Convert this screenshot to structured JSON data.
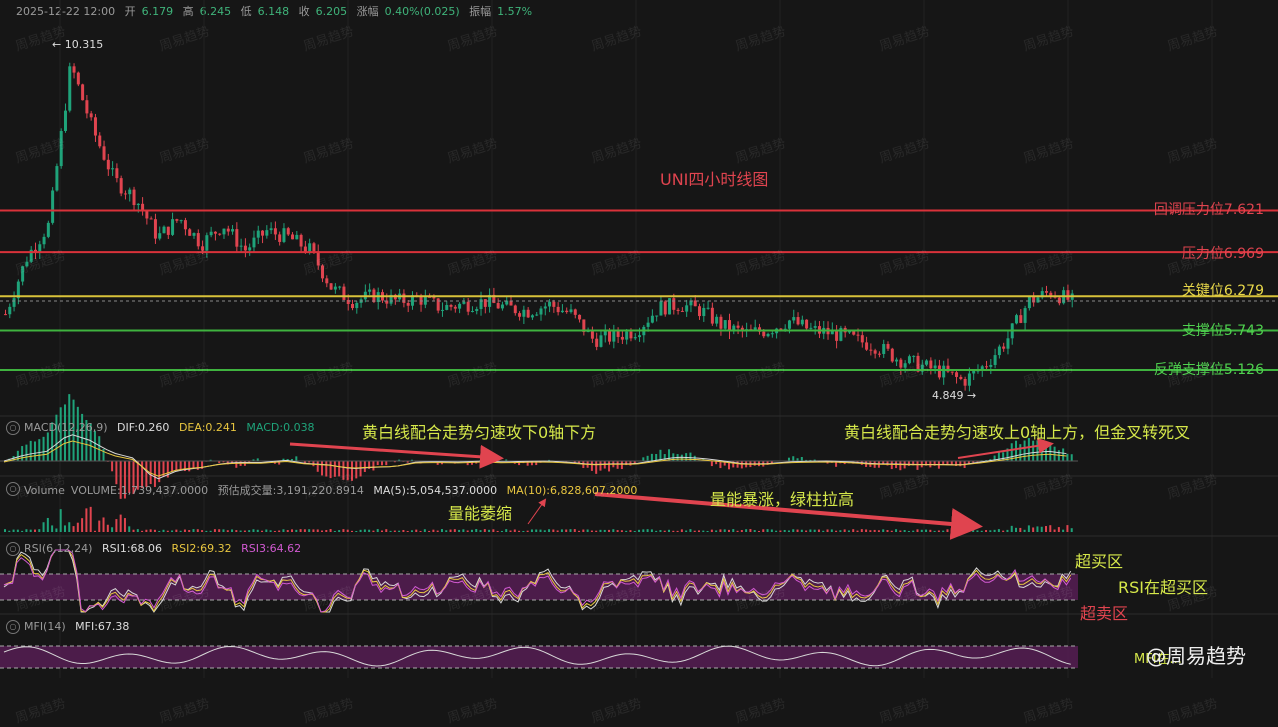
{
  "header": {
    "datetime": "2025-12-22 12:00",
    "open_label": "开",
    "open": "6.179",
    "high_label": "高",
    "high": "6.245",
    "low_label": "低",
    "low": "6.148",
    "close_label": "收",
    "close": "6.205",
    "change_label": "涨幅",
    "change": "0.40%(0.025)",
    "amplitude_label": "振幅",
    "amplitude": "1.57%"
  },
  "chart_data": {
    "type": "candlestick",
    "title": "UNI四小时线图",
    "ylim": [
      4.5,
      10.6
    ],
    "high_marker": "10.315",
    "low_marker": "4.849",
    "levels": [
      {
        "label": "回调压力位7.621",
        "value": 7.621,
        "color": "#d9323a"
      },
      {
        "label": "压力位6.969",
        "value": 6.969,
        "color": "#d9323a"
      },
      {
        "label": "关键位6.279",
        "value": 6.279,
        "color": "#d8c23a"
      },
      {
        "label": "支撑位5.743",
        "value": 5.743,
        "color": "#3fb33f"
      },
      {
        "label": "反弹支撑位5.126",
        "value": 5.126,
        "color": "#3fb33f"
      }
    ],
    "trend_close": [
      6.0,
      6.9,
      7.4,
      9.9,
      8.9,
      8.1,
      7.8,
      7.2,
      7.5,
      7.1,
      7.4,
      7.0,
      7.3,
      7.2,
      7.0,
      6.4,
      6.2,
      6.3,
      6.2,
      6.25,
      6.1,
      6.15,
      6.2,
      6.1,
      6.05,
      6.15,
      6.0,
      5.6,
      5.65,
      5.75,
      6.1,
      6.15,
      6.05,
      5.8,
      5.7,
      5.75,
      5.9,
      5.75,
      5.7,
      5.6,
      5.5,
      5.3,
      5.2,
      5.1,
      4.95,
      5.2,
      5.6,
      6.2,
      6.35,
      6.2
    ],
    "macd": {
      "label": "MACD(12,26,9)",
      "dif": "DIF:0.260",
      "dea": "DEA:0.241",
      "macd": "MACD:0.038"
    },
    "volume": {
      "label": "Volume",
      "volume": "VOLUME:1,739,437.0000",
      "estimate": "预估成交量:3,191,220.8914",
      "ma5": "MA(5):5,054,537.0000",
      "ma10": "MA(10):6,828,607.2000"
    },
    "rsi": {
      "label": "RSI(6,12,24)",
      "rsi1": "RSI1:68.06",
      "rsi2": "RSI2:69.32",
      "rsi3": "RSI3:64.62"
    },
    "mfi": {
      "label": "MFI(14)",
      "mfi": "MFI:67.38"
    }
  },
  "annotations": {
    "macd_left": "黄白线配合走势匀速攻下0轴下方",
    "macd_right": "黄白线配合走势匀速攻上0轴上方，但金叉转死叉",
    "vol_shrink": "量能萎缩",
    "vol_surge": "量能暴涨，绿柱拉高",
    "overbought": "超买区",
    "rsi_in_overbought": "RSI在超买区",
    "oversold": "超卖区",
    "mfi_partial": "MFI在..."
  },
  "watermark": "周易趋势",
  "brand": "@周易趋势",
  "colors": {
    "up": "#1fa37a",
    "down": "#e0444f",
    "yellow": "#e8c640",
    "white": "#d8d8d8",
    "purple": "#5a1e58"
  }
}
